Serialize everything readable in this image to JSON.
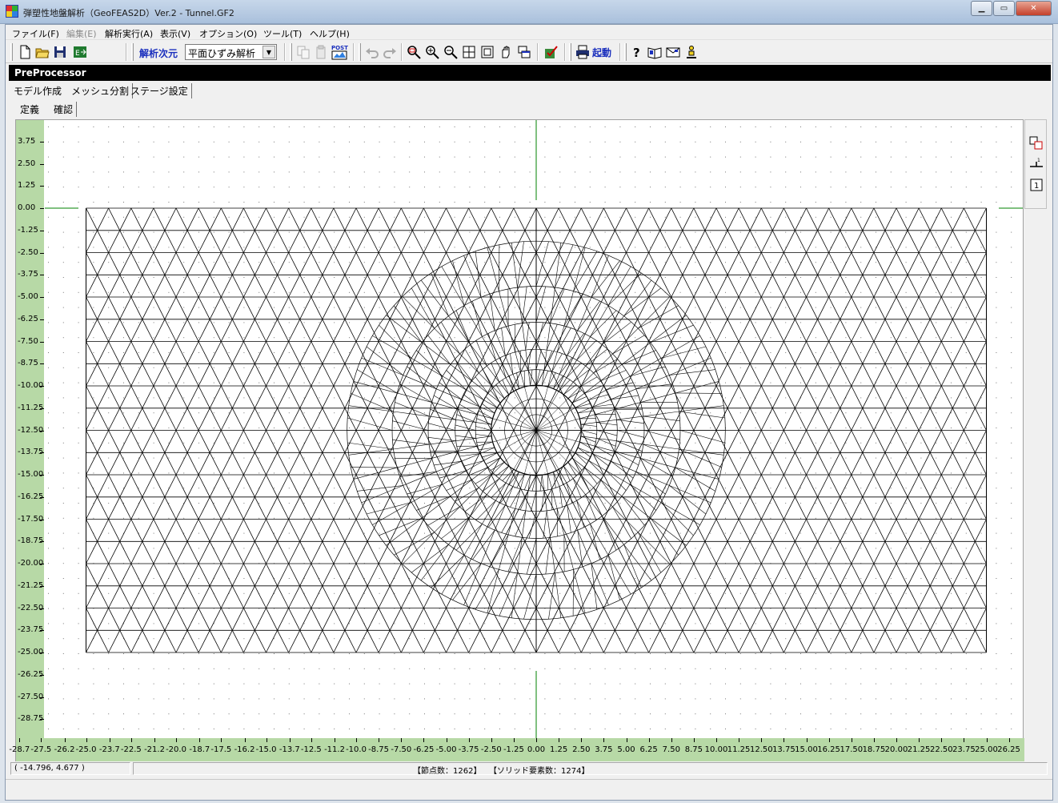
{
  "window": {
    "title": "弾塑性地盤解析（GeoFEAS2D）Ver.2 - Tunnel.GF2",
    "buttons": [
      "minimize",
      "maximize",
      "close"
    ]
  },
  "menu": [
    {
      "label": "ファイル(F)",
      "enabled": true
    },
    {
      "label": "編集(E)",
      "enabled": false
    },
    {
      "label": "解析実行(A)",
      "enabled": true
    },
    {
      "label": "表示(V)",
      "enabled": true
    },
    {
      "label": "オプション(O)",
      "enabled": true
    },
    {
      "label": "ツール(T)",
      "enabled": true
    },
    {
      "label": "ヘルプ(H)",
      "enabled": true
    }
  ],
  "toolbar": {
    "dimension_label": "解析次元",
    "dimension_value": "平面ひずみ解析",
    "post_label": "POST",
    "launch_label": "起動"
  },
  "panel": {
    "title": "PreProcessor",
    "main_tabs": [
      "モデル作成",
      "メッシュ分割",
      "ステージ設定"
    ],
    "main_tab_active": 1,
    "sub_tabs": [
      "定義",
      "確認"
    ],
    "sub_tab_active": 1
  },
  "axes": {
    "y_ticks": [
      "3.75",
      "2.50",
      "1.25",
      "0.00",
      "-1.25",
      "-2.50",
      "-3.75",
      "-5.00",
      "-6.25",
      "-7.50",
      "-8.75",
      "-10.00",
      "-11.25",
      "-12.50",
      "-13.75",
      "-15.00",
      "-16.25",
      "-17.50",
      "-18.75",
      "-20.00",
      "-21.25",
      "-22.50",
      "-23.75",
      "-25.00",
      "-26.25",
      "-27.50",
      "-28.75"
    ],
    "x_ticks": [
      "-28.7",
      "-27.5",
      "-26.2",
      "-25.0",
      "-23.7",
      "-22.5",
      "-21.2",
      "-20.0",
      "-18.7",
      "-17.5",
      "-16.2",
      "-15.0",
      "-13.7",
      "-12.5",
      "-11.2",
      "-10.0",
      "-8.75",
      "-7.50",
      "-6.25",
      "-5.00",
      "-3.75",
      "-2.50",
      "-1.25",
      "0.00",
      "1.25",
      "2.50",
      "3.75",
      "5.00",
      "6.25",
      "7.50",
      "8.75",
      "10.00",
      "11.25",
      "12.50",
      "13.75",
      "15.00",
      "16.25",
      "17.50",
      "18.75",
      "20.00",
      "21.25",
      "22.50",
      "23.75",
      "25.00",
      "26.25"
    ]
  },
  "mesh": {
    "x_min": -25.0,
    "x_max": 25.0,
    "y_min": -25.0,
    "y_max": 0.0,
    "tunnel_center": [
      0.0,
      -12.5
    ],
    "tunnel_radius": 2.5
  },
  "status": {
    "coords": "( -14.796,    4.677 )",
    "nodes": "【節点数：1262】",
    "elements": "【ソリッド要素数：1274】"
  },
  "colors": {
    "ruler": "#b7d9a6",
    "axis_line": "#008000",
    "mesh_line": "#000000",
    "accent_label": "#1a2fbd"
  }
}
